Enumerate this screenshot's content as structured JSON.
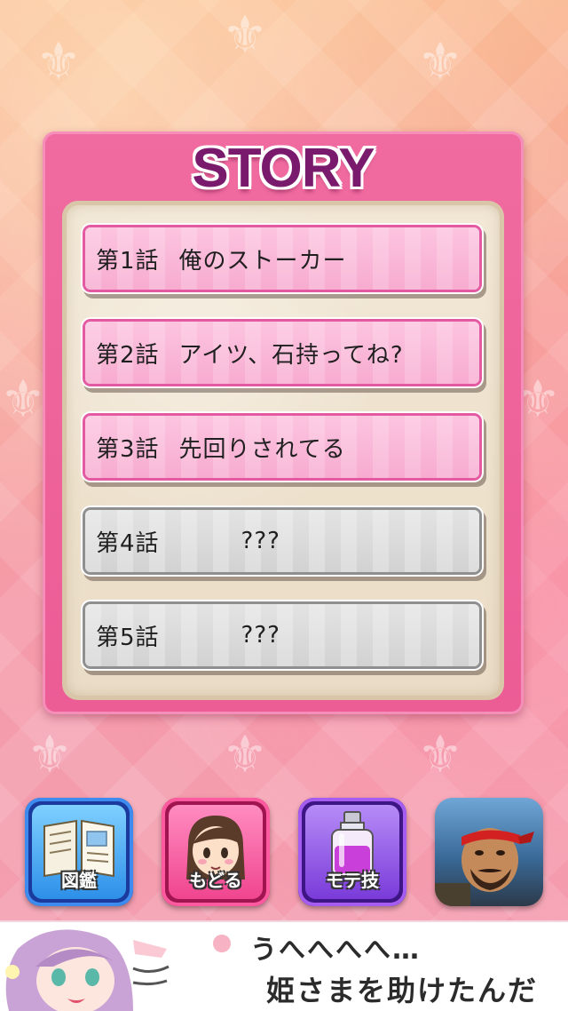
{
  "panel": {
    "title": "STORY"
  },
  "episodes": [
    {
      "number": "第1話",
      "title": "俺のストーカー",
      "locked": false
    },
    {
      "number": "第2話",
      "title": "アイツ、石持ってね?",
      "locked": false
    },
    {
      "number": "第3話",
      "title": "先回りされてる",
      "locked": false
    },
    {
      "number": "第4話",
      "title": "???",
      "locked": true
    },
    {
      "number": "第5話",
      "title": "???",
      "locked": true
    }
  ],
  "nav": {
    "zukan_label": "図鑑",
    "modoru_label": "もどる",
    "mote_label": "モテ技"
  },
  "banner": {
    "line1": "うへへへへ…",
    "line2": "姫さまを助けたんだ"
  },
  "colors": {
    "panel_pink": "#ec5c95",
    "title_purple": "#7a1a6d",
    "unlocked_pink": "#f7abd0",
    "locked_gray": "#d2d2d2"
  }
}
